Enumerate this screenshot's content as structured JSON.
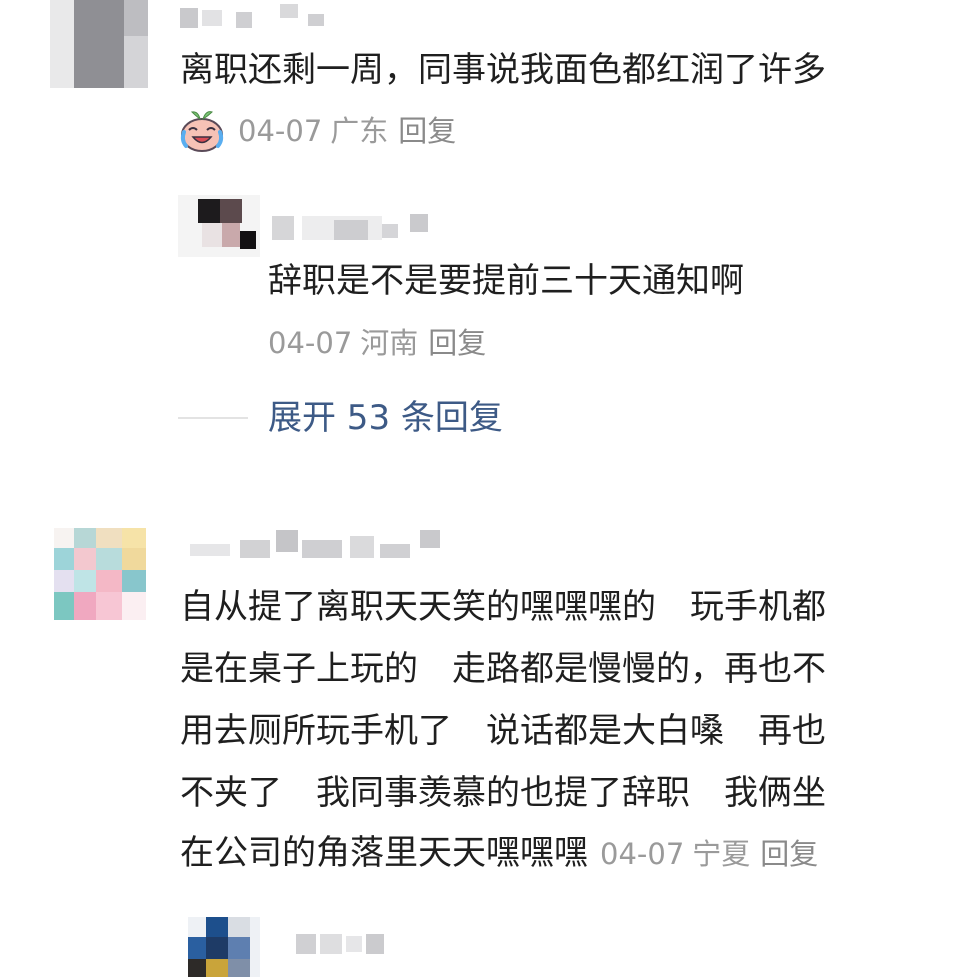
{
  "comments": [
    {
      "text": "离职还剩一周，同事说我面色都红润了许多",
      "date": "04-07",
      "location": "广东",
      "reply_label": "回复",
      "replies": [
        {
          "text": "辞职是不是要提前三十天通知啊",
          "date": "04-07",
          "location": "河南",
          "reply_label": "回复"
        }
      ],
      "expand_label": "展开 53 条回复"
    },
    {
      "lines": [
        "自从提了离职天天笑的嘿嘿嘿的　玩手机都",
        "是在桌子上玩的　走路都是慢慢的，再也不",
        "用去厕所玩手机了　说话都是大白嗓　再也",
        "不夹了　我同事羡慕的也提了辞职　我俩坐",
        "在公司的角落里天天嘿嘿嘿"
      ],
      "date": "04-07",
      "location": "宁夏",
      "reply_label": "回复"
    }
  ],
  "colors": {
    "text": "#1f1f1f",
    "meta": "#9a9a9a",
    "link": "#3d5a86",
    "divider": "#e3e3e3"
  },
  "icons": {
    "reaction": "laughing-crying-emoji-icon"
  }
}
